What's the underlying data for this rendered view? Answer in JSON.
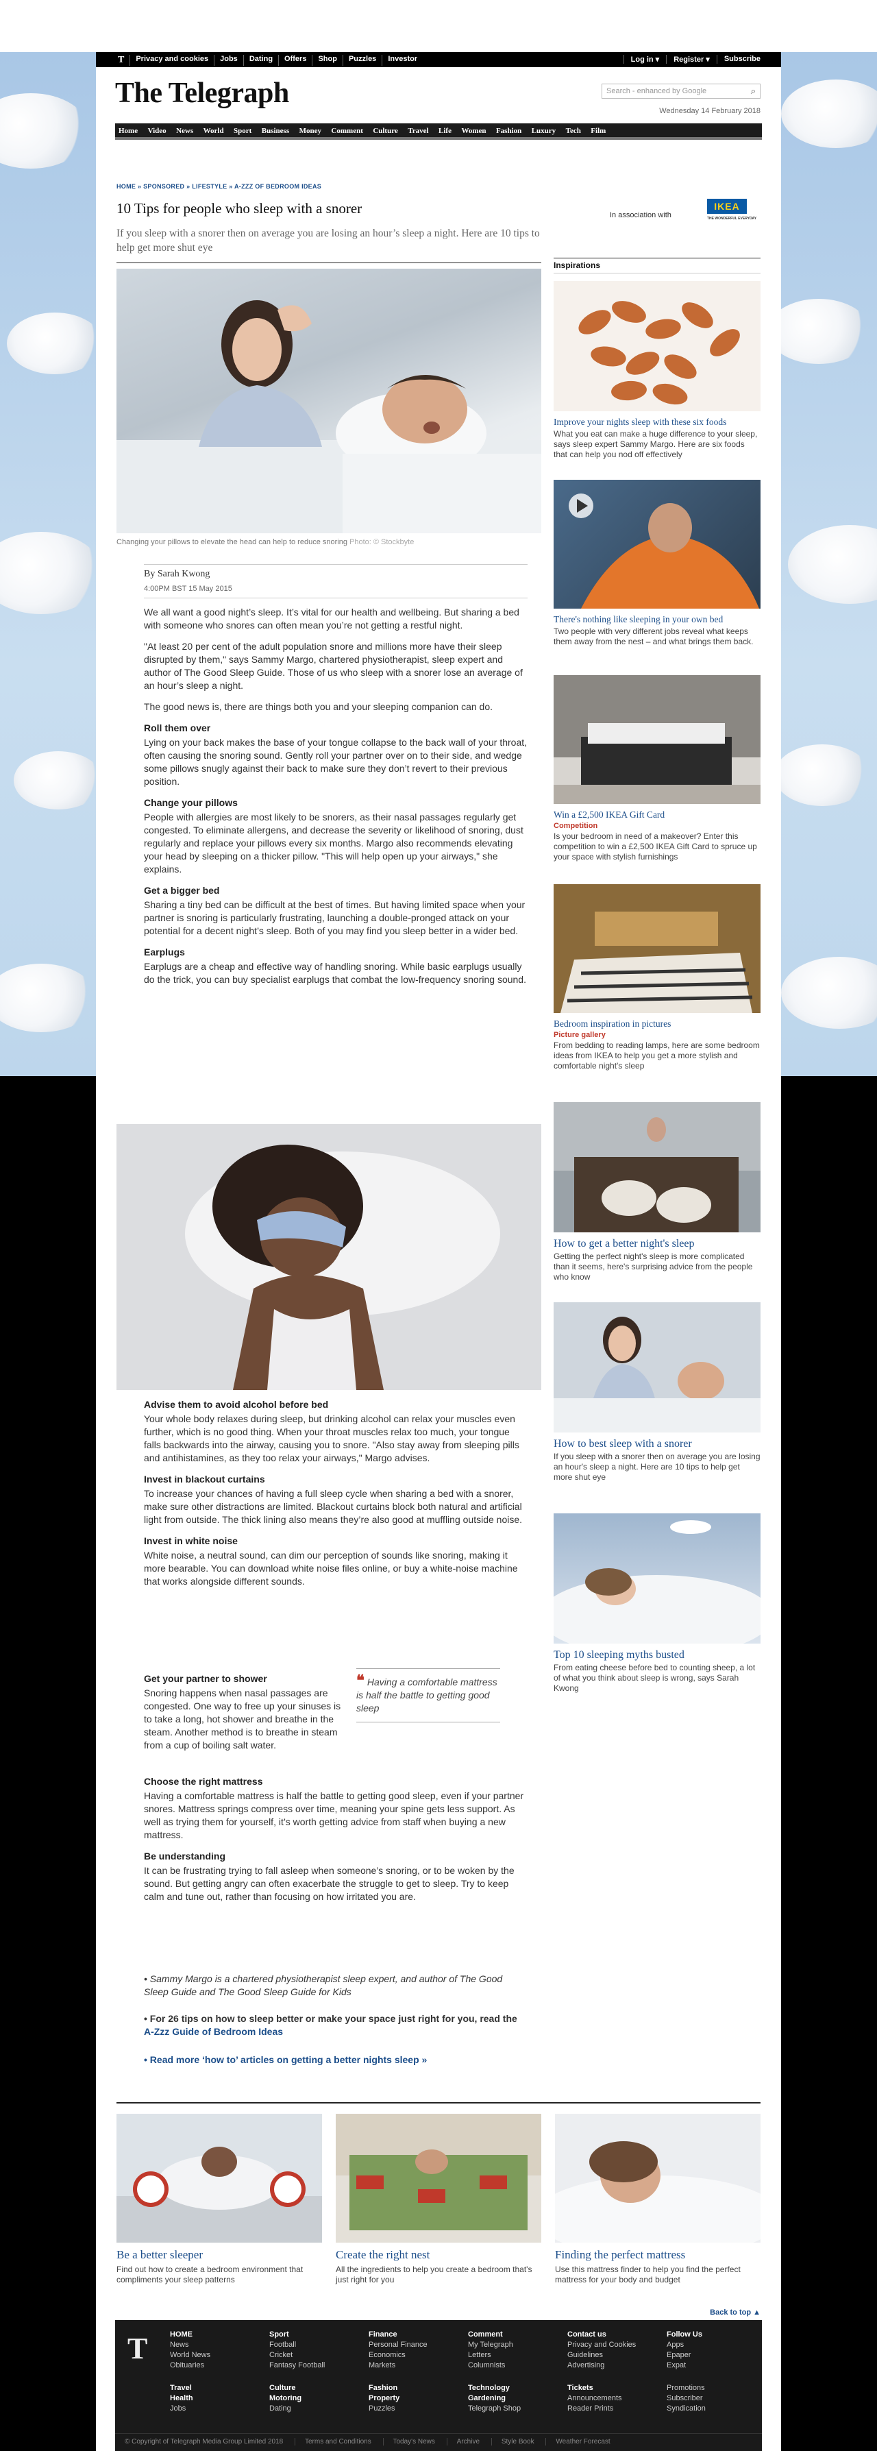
{
  "topbar": {
    "logo": "T",
    "links": [
      "Privacy and cookies",
      "Jobs",
      "Dating",
      "Offers",
      "Shop",
      "Puzzles",
      "Investor"
    ],
    "right_links": [
      "Log in ▾",
      "Register ▾",
      "Subscribe"
    ]
  },
  "masthead": "The Telegraph",
  "search": {
    "placeholder": "Search - enhanced by Google"
  },
  "date": "Wednesday 14 February 2018",
  "nav": [
    "Home",
    "Video",
    "News",
    "World",
    "Sport",
    "Business",
    "Money",
    "Comment",
    "Culture",
    "Travel",
    "Life",
    "Women",
    "Fashion",
    "Luxury",
    "Tech",
    "Film"
  ],
  "breadcrumb": "HOME » SPONSORED » LIFESTYLE » A-ZZZ OF BEDROOM IDEAS",
  "headline": "10 Tips for people who sleep with a snorer",
  "standfirst": "If you sleep with a snorer then on average you are losing an hour’s sleep a night. Here are 10 tips to help get more shut eye",
  "association": {
    "label": "In association with",
    "brand": "IKEA",
    "sub": "THE WONDERFUL EVERYDAY"
  },
  "hero_caption": {
    "text": "Changing your pillows to elevate the head can help to reduce snoring",
    "photo": "Photo: © Stockbyte"
  },
  "byline": "By Sarah Kwong",
  "published": "4:00PM BST 15 May 2015",
  "article": {
    "intro": [
      "We all want a good night’s sleep. It’s vital for our health and wellbeing. But sharing a bed with someone who snores can often mean you’re not getting a restful night.",
      "\"At least 20 per cent of the adult population snore and millions more have their sleep disrupted by them,\" says Sammy Margo, chartered physiotherapist, sleep expert and author of The Good Sleep Guide. Those of us who sleep with a snorer lose an average of an hour’s sleep a night.",
      "The good news is, there are things both you and your sleeping companion can do."
    ],
    "sections1": [
      {
        "h": "Roll them over",
        "p": "Lying on your back makes the base of your tongue collapse to the back wall of your throat, often causing the snoring sound. Gently roll your partner over on to their side, and wedge some pillows snugly against their back to make sure they don’t revert to their previous position."
      },
      {
        "h": "Change your pillows",
        "p": "People with allergies are most likely to be snorers, as their nasal passages regularly get congested. To eliminate allergens, and decrease the severity or likelihood of snoring, dust regularly and replace your pillows every six months. Margo also recommends elevating your head by sleeping on a thicker pillow. \"This will help open up your airways,\" she explains."
      },
      {
        "h": "Get a bigger bed",
        "p": "Sharing a tiny bed can be difficult at the best of times. But having limited space when your partner is snoring is particularly frustrating, launching a double-pronged attack on your potential for a decent night’s sleep. Both of you may find you sleep better in a wider bed."
      },
      {
        "h": "Earplugs",
        "p": "Earplugs are a cheap and effective way of handling snoring. While basic earplugs usually do the trick, you can buy specialist earplugs that combat the low-frequency snoring sound."
      }
    ],
    "sections2": [
      {
        "h": "Advise them to avoid alcohol before bed",
        "p": "Your whole body relaxes during sleep, but drinking alcohol can relax your muscles even further, which is no good thing. When your throat muscles relax too much, your tongue falls backwards into the airway, causing you to snore. \"Also stay away from sleeping pills and antihistamines, as they too relax your airways,\" Margo advises."
      },
      {
        "h": "Invest in blackout curtains",
        "p": "To increase your chances of having a full sleep cycle when sharing a bed with a snorer, make sure other distractions are limited. Blackout curtains block both natural and artificial light from outside. The thick lining also means they’re also good at muffling outside noise."
      },
      {
        "h": "Invest in white noise",
        "p": "White noise, a neutral sound, can dim our perception of sounds like snoring, making it more bearable. You can download white noise files online, or buy a white-noise machine that works alongside different sounds."
      }
    ],
    "shower": {
      "h": "Get your partner to shower",
      "p": "Snoring happens when nasal passages are congested. One way to free up your sinuses is to take a long, hot shower and breathe in the steam. Another method is to breathe in steam from a cup of boiling salt water."
    },
    "sections3": [
      {
        "h": "Choose the right mattress",
        "p": "Having a comfortable mattress is half the battle to getting good sleep, even if your partner snores. Mattress springs compress over time, meaning your spine gets less support. As well as trying them for yourself, it’s worth getting advice from staff when buying a new mattress."
      },
      {
        "h": "Be understanding",
        "p": "It can be frustrating trying to fall asleep when someone’s snoring, or to be woken by the sound. But getting angry can often exacerbate the struggle to get to sleep. Try to keep calm and tune out, rather than focusing on how irritated you are."
      }
    ],
    "pullquote": "Having a comfortable mattress is half the battle to getting good sleep",
    "footnote": "• Sammy Margo is a chartered physiotherapist sleep expert, and author of The Good Sleep Guide and The Good Sleep Guide for Kids",
    "cta1_prefix": "• For 26 tips on how to sleep better or make your space just right for you, read the ",
    "cta1_link": "A-Zzz Guide of Bedroom Ideas",
    "cta2": "• Read more ‘how to’ articles on getting a better nights sleep »"
  },
  "sidebar": {
    "heading": "Inspirations",
    "cards": [
      {
        "title": "Improve your nights sleep with these six foods",
        "tag": "",
        "desc": "What you eat can make a huge difference to your sleep, says sleep expert Sammy Margo. Here are six foods that can help you nod off effectively"
      },
      {
        "title": "There's nothing like sleeping in your own bed",
        "tag": "",
        "desc": "Two people with very different jobs reveal what keeps them away from the nest – and what brings them back."
      },
      {
        "title": "Win a £2,500 IKEA Gift Card",
        "tag": "Competition",
        "desc": "Is your bedroom in need of a makeover? Enter this competition to win a £2,500 IKEA Gift Card to spruce up your space with stylish furnishings"
      },
      {
        "title": "Bedroom inspiration in pictures",
        "tag": "Picture gallery",
        "desc": "From bedding to reading lamps, here are some bedroom ideas from IKEA to help you get a more stylish and comfortable night's sleep"
      },
      {
        "title": "How to get a better night's sleep",
        "tag": "",
        "desc": "Getting the perfect night's sleep is more complicated than it seems, here's surprising advice from the people who know"
      },
      {
        "title": "How to best sleep with a snorer",
        "tag": "",
        "desc": "If you sleep with a snorer then on average you are losing an hour's sleep a night. Here are 10 tips to help get more shut eye"
      },
      {
        "title": "Top 10 sleeping myths busted",
        "tag": "",
        "desc": "From eating cheese before bed to counting sheep, a lot of what you think about sleep is wrong, says Sarah Kwong"
      }
    ]
  },
  "promos": [
    {
      "title": "Be a better sleeper",
      "desc": "Find out how to create a bedroom environment that compliments your sleep patterns"
    },
    {
      "title": "Create the right nest",
      "desc": "All the ingredients to help you create a bedroom that's just right for you"
    },
    {
      "title": "Finding the perfect mattress",
      "desc": "Use this mattress finder to help you find the perfect mattress for your body and budget"
    }
  ],
  "back_to_top": "Back to top ▲",
  "footer": {
    "logo": "T",
    "columns": [
      {
        "hd": "HOME",
        "items": [
          "News",
          "World News",
          "Obituaries"
        ]
      },
      {
        "hd": "Sport",
        "items": [
          "Football",
          "Cricket",
          "Fantasy Football"
        ]
      },
      {
        "hd": "Finance",
        "items": [
          "Personal Finance",
          "Economics",
          "Markets"
        ]
      },
      {
        "hd": "Comment",
        "items": [
          "My Telegraph",
          "Letters",
          "Columnists"
        ]
      },
      {
        "hd": "Contact us",
        "items": [
          "Privacy and Cookies",
          "Guidelines",
          "Advertising"
        ]
      },
      {
        "hd": "Follow Us",
        "items": [
          "Apps",
          "Epaper",
          "Expat"
        ]
      }
    ],
    "columns2": [
      {
        "hd": "Travel",
        "items": [
          "Health",
          "Jobs"
        ]
      },
      {
        "hd": "Culture",
        "items": [
          "Motoring",
          "Dating"
        ]
      },
      {
        "hd": "Fashion",
        "items": [
          "Property",
          "Puzzles"
        ]
      },
      {
        "hd": "Technology",
        "items": [
          "Gardening",
          "Telegraph Shop"
        ]
      },
      {
        "hd": "Tickets",
        "items": [
          "Announcements",
          "Reader Prints"
        ]
      },
      {
        "hd": "Promotions",
        "items": [
          "Subscriber",
          "Syndication"
        ]
      }
    ],
    "bottom": [
      "© Copyright of Telegraph Media Group Limited 2018",
      "Terms and Conditions",
      "Today's News",
      "Archive",
      "Style Book",
      "Weather Forecast"
    ]
  }
}
